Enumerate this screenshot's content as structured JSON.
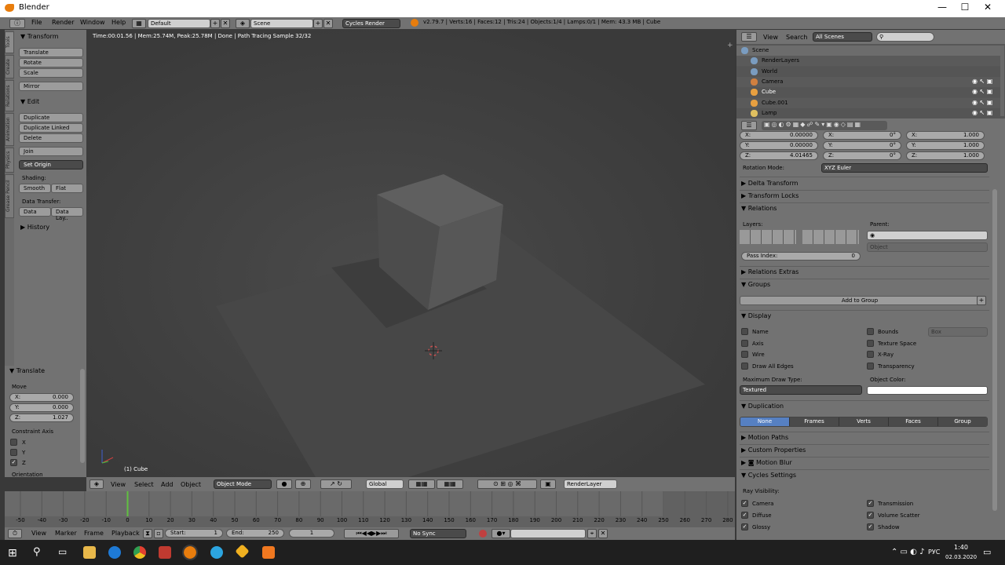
{
  "window": {
    "title": "Blender",
    "minimize": "—",
    "maximize": "☐",
    "close": "✕"
  },
  "menu": {
    "file": "File",
    "render": "Render",
    "window": "Window",
    "help": "Help"
  },
  "screen_layout": "Default",
  "scene": "Scene",
  "engine": "Cycles Render",
  "stats": "v2.79.7 | Verts:16 | Faces:12 | Tris:24 | Objects:1/4 | Lamps:0/1 | Mem: 43.3 MB | Cube",
  "tool_tabs": [
    "Tools",
    "Create",
    "Relations",
    "Animation",
    "Physics",
    "Grease Pencil"
  ],
  "tools": {
    "transform_header": "Transform",
    "translate": "Translate",
    "rotate": "Rotate",
    "scale": "Scale",
    "mirror": "Mirror",
    "edit_header": "Edit",
    "duplicate": "Duplicate",
    "duplicate_linked": "Duplicate Linked",
    "delete": "Delete",
    "join": "Join",
    "set_origin": "Set Origin",
    "shading_label": "Shading:",
    "smooth": "Smooth",
    "flat": "Flat",
    "data_transfer_label": "Data Transfer:",
    "data": "Data",
    "data_layout": "Data Lay..",
    "history": "History"
  },
  "operator": {
    "title": "Translate",
    "move_label": "Move",
    "x_label": "X:",
    "x": "0.000",
    "y_label": "Y:",
    "y": "0.000",
    "z_label": "Z:",
    "z": "1.027",
    "constraint_label": "Constraint Axis",
    "cx": "X",
    "cy": "Y",
    "cz": "Z",
    "orientation": "Orientation"
  },
  "viewport": {
    "render_info": "Time:00:01.56 | Mem:25.74M, Peak:25.78M | Done | Path Tracing Sample 32/32",
    "object_label": "(1) Cube"
  },
  "view_header": {
    "view": "View",
    "select": "Select",
    "add": "Add",
    "object": "Object",
    "mode": "Object Mode",
    "orientation": "Global",
    "render_layer": "RenderLayer"
  },
  "timeline": {
    "ticks": [
      "-50",
      "-40",
      "-30",
      "-20",
      "-10",
      "0",
      "10",
      "20",
      "30",
      "40",
      "50",
      "60",
      "70",
      "80",
      "90",
      "100",
      "110",
      "120",
      "130",
      "140",
      "150",
      "160",
      "170",
      "180",
      "190",
      "200",
      "210",
      "220",
      "230",
      "240",
      "250",
      "260",
      "270",
      "280"
    ],
    "current_frame": 0,
    "view": "View",
    "marker": "Marker",
    "frame": "Frame",
    "playback": "Playback",
    "start_label": "Start:",
    "start": "1",
    "end_label": "End:",
    "end": "250",
    "current": "1",
    "sync": "No Sync"
  },
  "outliner": {
    "view": "View",
    "search": "Search",
    "filter": "All Scenes",
    "items": [
      {
        "name": "Scene",
        "depth": 0
      },
      {
        "name": "RenderLayers",
        "depth": 1
      },
      {
        "name": "World",
        "depth": 1
      },
      {
        "name": "Camera",
        "depth": 1
      },
      {
        "name": "Cube",
        "depth": 1
      },
      {
        "name": "Cube.001",
        "depth": 1
      },
      {
        "name": "Lamp",
        "depth": 1
      }
    ]
  },
  "properties": {
    "loc_x_label": "X:",
    "loc_x": "0.00000",
    "loc_y_label": "Y:",
    "loc_y": "0.00000",
    "loc_z_label": "Z:",
    "loc_z": "4.01465",
    "rot_x_label": "X:",
    "rot_x": "0°",
    "rot_y_label": "Y:",
    "rot_y": "0°",
    "rot_z_label": "Z:",
    "rot_z": "0°",
    "scl_x_label": "X:",
    "scl_x": "1.000",
    "scl_y_label": "Y:",
    "scl_y": "1.000",
    "scl_z_label": "Z:",
    "scl_z": "1.000",
    "rotation_mode_label": "Rotation Mode:",
    "rotation_mode": "XYZ Euler",
    "delta_transform": "Delta Transform",
    "transform_locks": "Transform Locks",
    "relations": "Relations",
    "layers_label": "Layers:",
    "parent_label": "Parent:",
    "parent_type": "Object",
    "pass_index_label": "Pass Index:",
    "pass_index": "0",
    "relations_extras": "Relations Extras",
    "groups": "Groups",
    "add_to_group": "Add to Group",
    "display": "Display",
    "name": "Name",
    "axis": "Axis",
    "wire": "Wire",
    "draw_all_edges": "Draw All Edges",
    "bounds": "Bounds",
    "bounds_type": "Box",
    "texture_space": "Texture Space",
    "xray": "X-Ray",
    "transparency": "Transparency",
    "max_draw_type_label": "Maximum Draw Type:",
    "max_draw_type": "Textured",
    "object_color_label": "Object Color:",
    "duplication": "Duplication",
    "dup_none": "None",
    "dup_frames": "Frames",
    "dup_verts": "Verts",
    "dup_faces": "Faces",
    "dup_group": "Group",
    "motion_paths": "Motion Paths",
    "custom_properties": "Custom Properties",
    "motion_blur": "Motion Blur",
    "cycles_settings": "Cycles Settings",
    "ray_visibility_label": "Ray Visibility:",
    "camera": "Camera",
    "diffuse": "Diffuse",
    "glossy": "Glossy",
    "transmission": "Transmission",
    "volume_scatter": "Volume Scatter",
    "shadow": "Shadow"
  },
  "taskbar": {
    "lang": "РУС",
    "time": "1:40",
    "date": "02.03.2020"
  },
  "colors": {
    "selection": "#5680c2",
    "viewport_bg": "#3f3f3f",
    "frame_line": "#60c040"
  }
}
